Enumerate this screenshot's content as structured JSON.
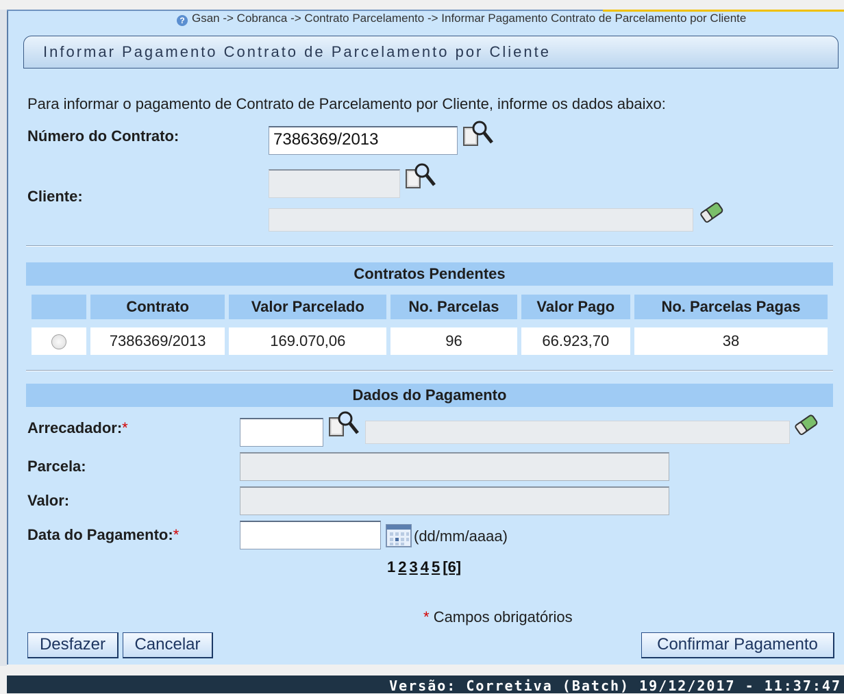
{
  "breadcrumb": "Gsan -> Cobranca -> Contrato Parcelamento -> Informar Pagamento Contrato de Parcelamento por Cliente",
  "page_title": "Informar Pagamento Contrato de Parcelamento por Cliente",
  "instructions": "Para informar o pagamento de Contrato de Parcelamento por Cliente, informe os dados abaixo:",
  "form": {
    "numero_contrato_label": "Número do Contrato:",
    "numero_contrato_value": "7386369/2013",
    "cliente_label": "Cliente:",
    "cliente_codigo": "",
    "cliente_nome": ""
  },
  "pending": {
    "section_title": "Contratos Pendentes",
    "columns": [
      "Contrato",
      "Valor Parcelado",
      "No. Parcelas",
      "Valor Pago",
      "No. Parcelas Pagas"
    ],
    "rows": [
      {
        "contrato": "7386369/2013",
        "valor_parcelado": "169.070,06",
        "parcelas": "96",
        "valor_pago": "66.923,70",
        "parcelas_pagas": "38"
      }
    ]
  },
  "payment": {
    "section_title": "Dados do Pagamento",
    "arrecadador_label": "Arrecadador:",
    "parcela_label": "Parcela:",
    "valor_label": "Valor:",
    "data_label": "Data do Pagamento:",
    "required_mark": "*",
    "date_hint": "(dd/mm/aaaa)"
  },
  "pager": {
    "current": "1",
    "pages": [
      "2",
      "3",
      "4",
      "5",
      "[6]"
    ]
  },
  "required_note": "Campos obrigatórios",
  "buttons": {
    "undo": "Desfazer",
    "cancel": "Cancelar",
    "confirm": "Confirmar Pagamento"
  },
  "footer_version": "Versão: Corretiva (Batch) 19/12/2017 - 11:37:47"
}
